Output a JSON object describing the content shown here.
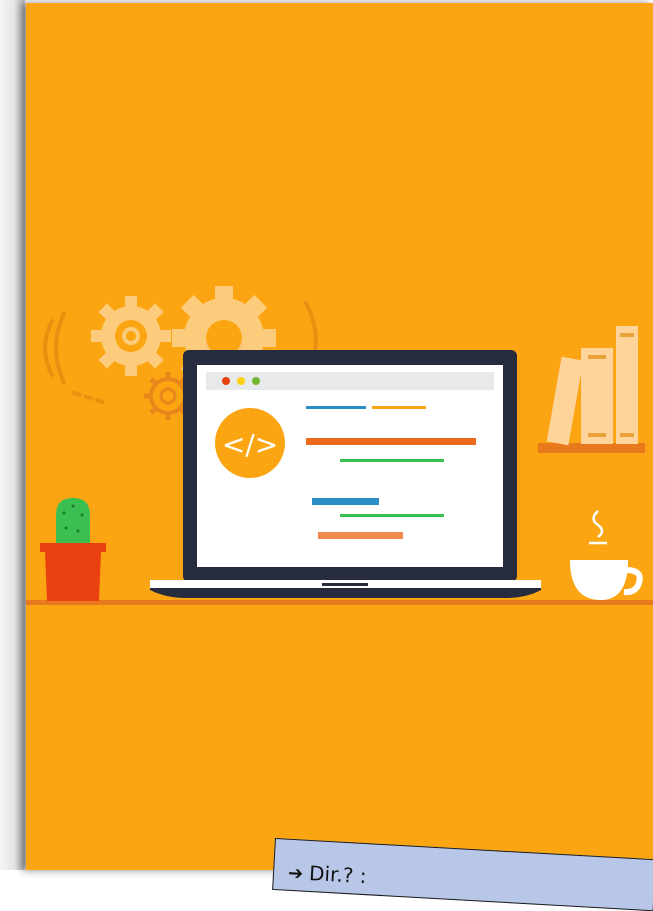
{
  "image": {
    "subject": "developer-workspace-illustration",
    "colors": {
      "background": "#fca512",
      "gear": "#fdcb7c",
      "laptop_body": "#262c3e",
      "screen": "#ffffff",
      "code_badge": "#fca512",
      "cactus": "#3bbf51",
      "pot": "#e8410f",
      "books": "#fed49a",
      "shelf": "#e8791c",
      "cup": "#ffffff",
      "window_dots": [
        "#e8410f",
        "#fcd013",
        "#74b531"
      ]
    }
  },
  "badge": {
    "code_symbol": "</>"
  },
  "tag": {
    "arrow_icon": "right-arrow-icon",
    "text": "Dir.? :"
  }
}
